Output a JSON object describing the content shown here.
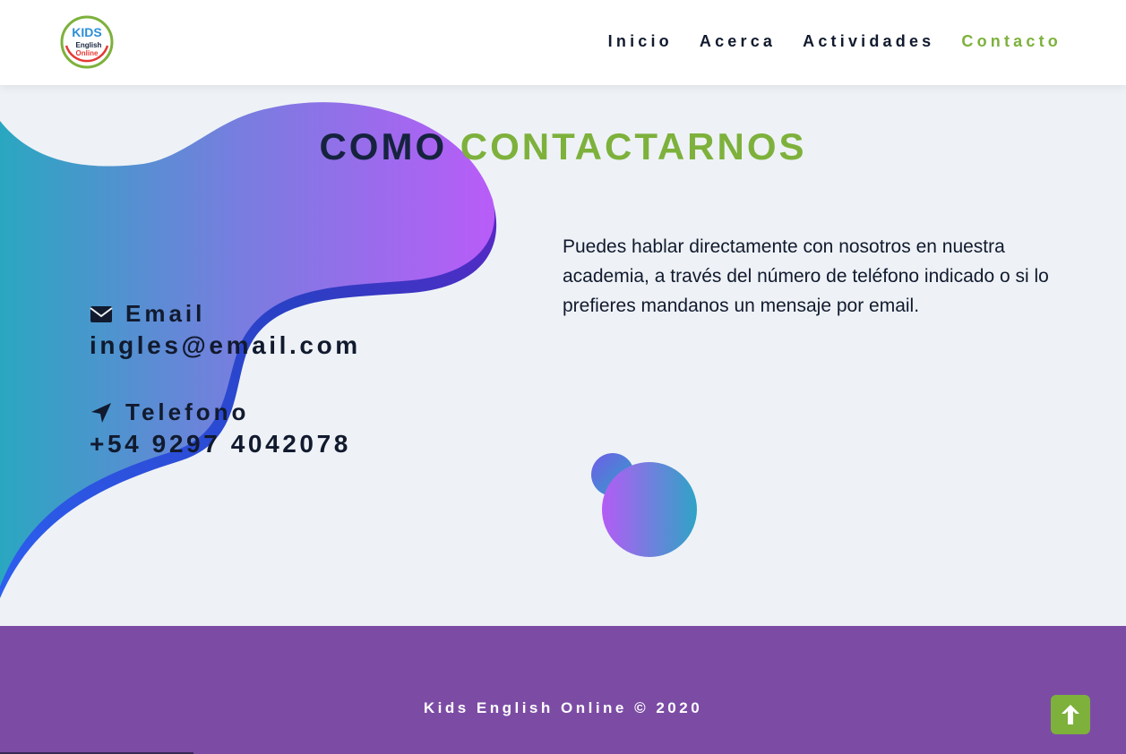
{
  "header": {
    "logo": {
      "line1": "KIDS",
      "line2": "English",
      "line3": "Online"
    },
    "nav": [
      {
        "label": "Inicio",
        "active": false
      },
      {
        "label": "Acerca",
        "active": false
      },
      {
        "label": "Actividades",
        "active": false
      },
      {
        "label": "Contacto",
        "active": true
      }
    ]
  },
  "contact": {
    "title_part1": "COMO",
    "title_part2": "CONTACTARNOS",
    "email_label": "Email",
    "email_value": "ingles@email.com",
    "phone_label": "Telefono",
    "phone_value": "+54 9297 4042078",
    "description": "Puedes hablar directamente con nosotros en nuestra academia, a través del número de teléfono indicado o si lo prefieres mandanos un mensaje por email.",
    "icons": {
      "email": "envelope-icon",
      "phone": "location-arrow-icon"
    }
  },
  "footer": {
    "copyright": "Kids English Online © 2020",
    "scroll_top_icon": "arrow-up-icon"
  },
  "colors": {
    "accent_green": "#7db13c",
    "footer_purple": "#7c4ca5",
    "text_dark": "#16233f",
    "background": "#eef2f6"
  }
}
